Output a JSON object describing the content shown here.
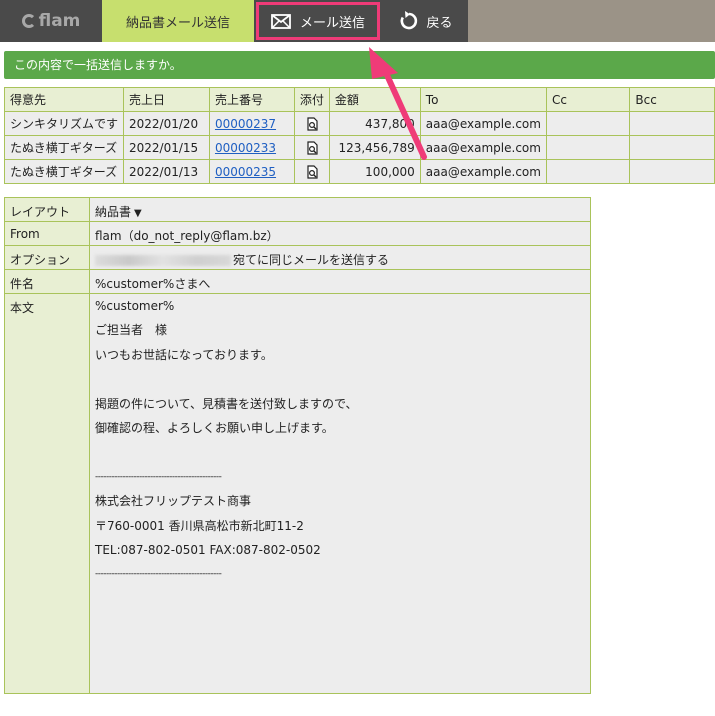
{
  "header": {
    "logo_text": "flam",
    "active_tab": "納品書メール送信",
    "send_button": "メール送信",
    "back_button": "戻る",
    "highlight_color": "#ef3b78",
    "accent_color": "#c7df6e"
  },
  "confirm_message": "この内容で一括送信しますか。",
  "list": {
    "columns": [
      "得意先",
      "売上日",
      "売上番号",
      "添付",
      "金額",
      "To",
      "Cc",
      "Bcc"
    ],
    "rows": [
      {
        "customer": "シンキタリズムです",
        "date": "2022/01/20",
        "number": "00000237",
        "attach_icon": "attachment-icon",
        "amount": "437,800",
        "to": "aaa@example.com",
        "cc": "",
        "bcc": ""
      },
      {
        "customer": "たぬき横丁ギターズ",
        "date": "2022/01/15",
        "number": "00000233",
        "attach_icon": "attachment-icon",
        "amount": "123,456,789",
        "to": "aaa@example.com",
        "cc": "",
        "bcc": ""
      },
      {
        "customer": "たぬき横丁ギターズ",
        "date": "2022/01/13",
        "number": "00000235",
        "attach_icon": "attachment-icon",
        "amount": "100,000",
        "to": "aaa@example.com",
        "cc": "",
        "bcc": ""
      }
    ]
  },
  "form": {
    "layout_label": "レイアウト",
    "layout_value": "納品書",
    "from_label": "From",
    "from_value": "flam（do_not_reply@flam.bz）",
    "option_label": "オプション",
    "option_value": "宛てに同じメールを送信する",
    "subject_label": "件名",
    "subject_value": "%customer%さまへ",
    "body_label": "本文",
    "body_lines": [
      "%customer%",
      "ご担当者　様",
      "いつもお世話になっております。",
      "",
      "掲題の件について、見積書を送付致しますので、",
      "御確認の程、よろしくお願い申し上げます。",
      "",
      "----------------------------------------------",
      "株式会社フリップテスト商事",
      "〒760-0001 香川県高松市新北町11-2",
      "TEL:087-802-0501 FAX:087-802-0502",
      "----------------------------------------------"
    ]
  }
}
